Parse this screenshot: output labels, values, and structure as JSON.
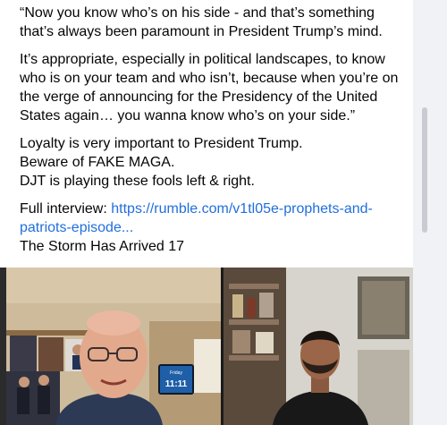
{
  "post": {
    "para1": "“Now you know who’s on his side - and that’s something that’s always been paramount in President Trump’s mind.",
    "para2": "It’s appropriate, especially in political landscapes, to know who is on your team and who isn’t, because when you’re on the verge of announcing for the Presidency of the United States again… you wanna know who’s on your side.”",
    "line1": "Loyalty is very important to President Trump.",
    "line2": "Beware of FAKE MAGA.",
    "line3": "DJT is playing these fools left & right.",
    "interview_prefix": "Full interview: ",
    "interview_link": "https://rumble.com/v1tl05e-prophets-and-patriots-episode...",
    "footer": "The Storm Has Arrived 17"
  },
  "video": {
    "clock_day": "Friday",
    "clock_time": "11:11"
  },
  "colors": {
    "link": "#216fdb",
    "text": "#050505"
  }
}
